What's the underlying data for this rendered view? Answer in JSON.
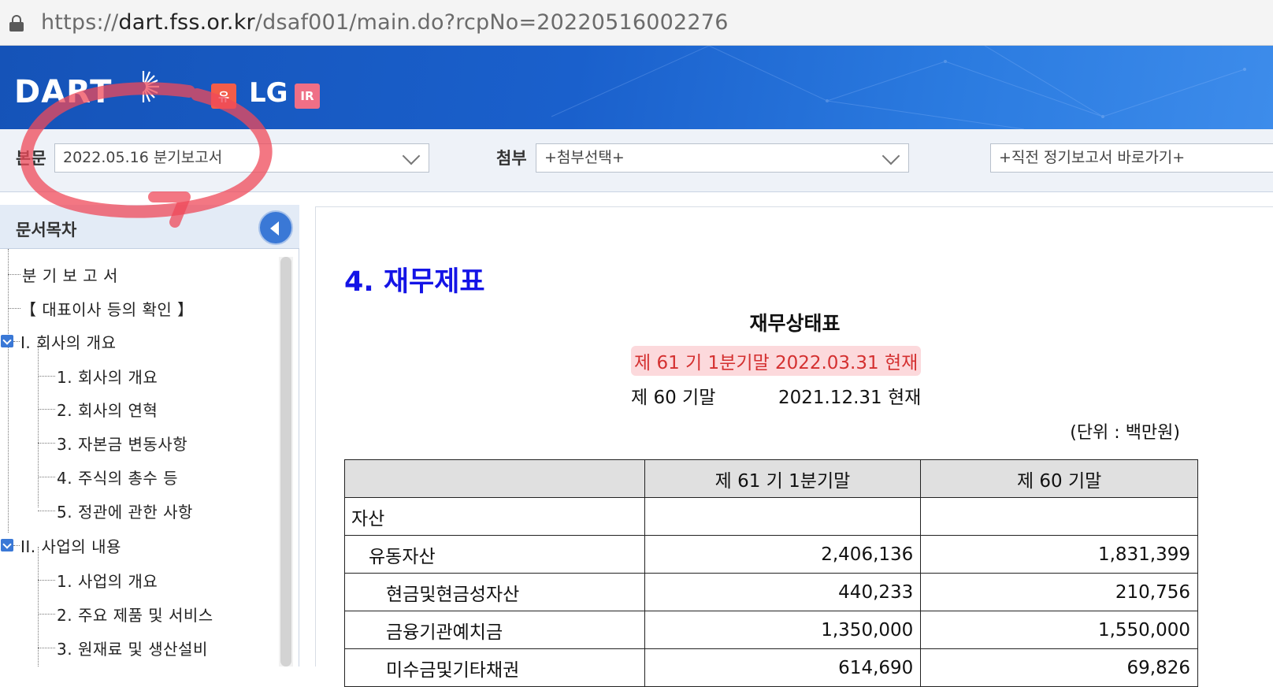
{
  "browser": {
    "url_scheme": "https://",
    "url_host": "dart.fss.or.kr",
    "url_path": "/dsaf001/main.do?rcpNo=20220516002276"
  },
  "header": {
    "logo_text": "DART",
    "badge_yu": "유",
    "company": "LG",
    "badge_ir": "IR"
  },
  "selectors": {
    "body_label": "본문",
    "body_value": "2022.05.16  분기보고서",
    "attach_label": "첨부",
    "attach_value": "+첨부선택+",
    "prev_value": "+직전 정기보고서 바로가기+"
  },
  "sidebar": {
    "title": "문서목차",
    "items": [
      {
        "label": "분 기 보 고 서"
      },
      {
        "label": "【 대표이사 등의 확인 】"
      },
      {
        "label": "I. 회사의 개요"
      },
      {
        "label": "1. 회사의 개요"
      },
      {
        "label": "2. 회사의 연혁"
      },
      {
        "label": "3. 자본금 변동사항"
      },
      {
        "label": "4. 주식의 총수 등"
      },
      {
        "label": "5. 정관에 관한 사항"
      },
      {
        "label": "II. 사업의 내용"
      },
      {
        "label": "1. 사업의 개요"
      },
      {
        "label": "2. 주요 제품 및 서비스"
      },
      {
        "label": "3. 원재료 및 생산설비"
      }
    ]
  },
  "main": {
    "section_title": "4. 재무제표",
    "statement_title": "재무상태표",
    "period_current": "제 61 기 1분기말 2022.03.31 현재",
    "period_prev_label": "제 60 기말",
    "period_prev_date": "2021.12.31 현재",
    "unit": "(단위 : 백만원)",
    "table": {
      "headers": [
        "",
        "제 61 기 1분기말",
        "제 60 기말"
      ],
      "rows": [
        {
          "account": "자산",
          "cur": "",
          "prev": ""
        },
        {
          "account": "유동자산",
          "cur": "2,406,136",
          "prev": "1,831,399"
        },
        {
          "account": "현금및현금성자산",
          "cur": "440,233",
          "prev": "210,756"
        },
        {
          "account": "금융기관예치금",
          "cur": "1,350,000",
          "prev": "1,550,000"
        },
        {
          "account": "미수금및기타채권",
          "cur": "614,690",
          "prev": "69,826"
        }
      ]
    }
  }
}
